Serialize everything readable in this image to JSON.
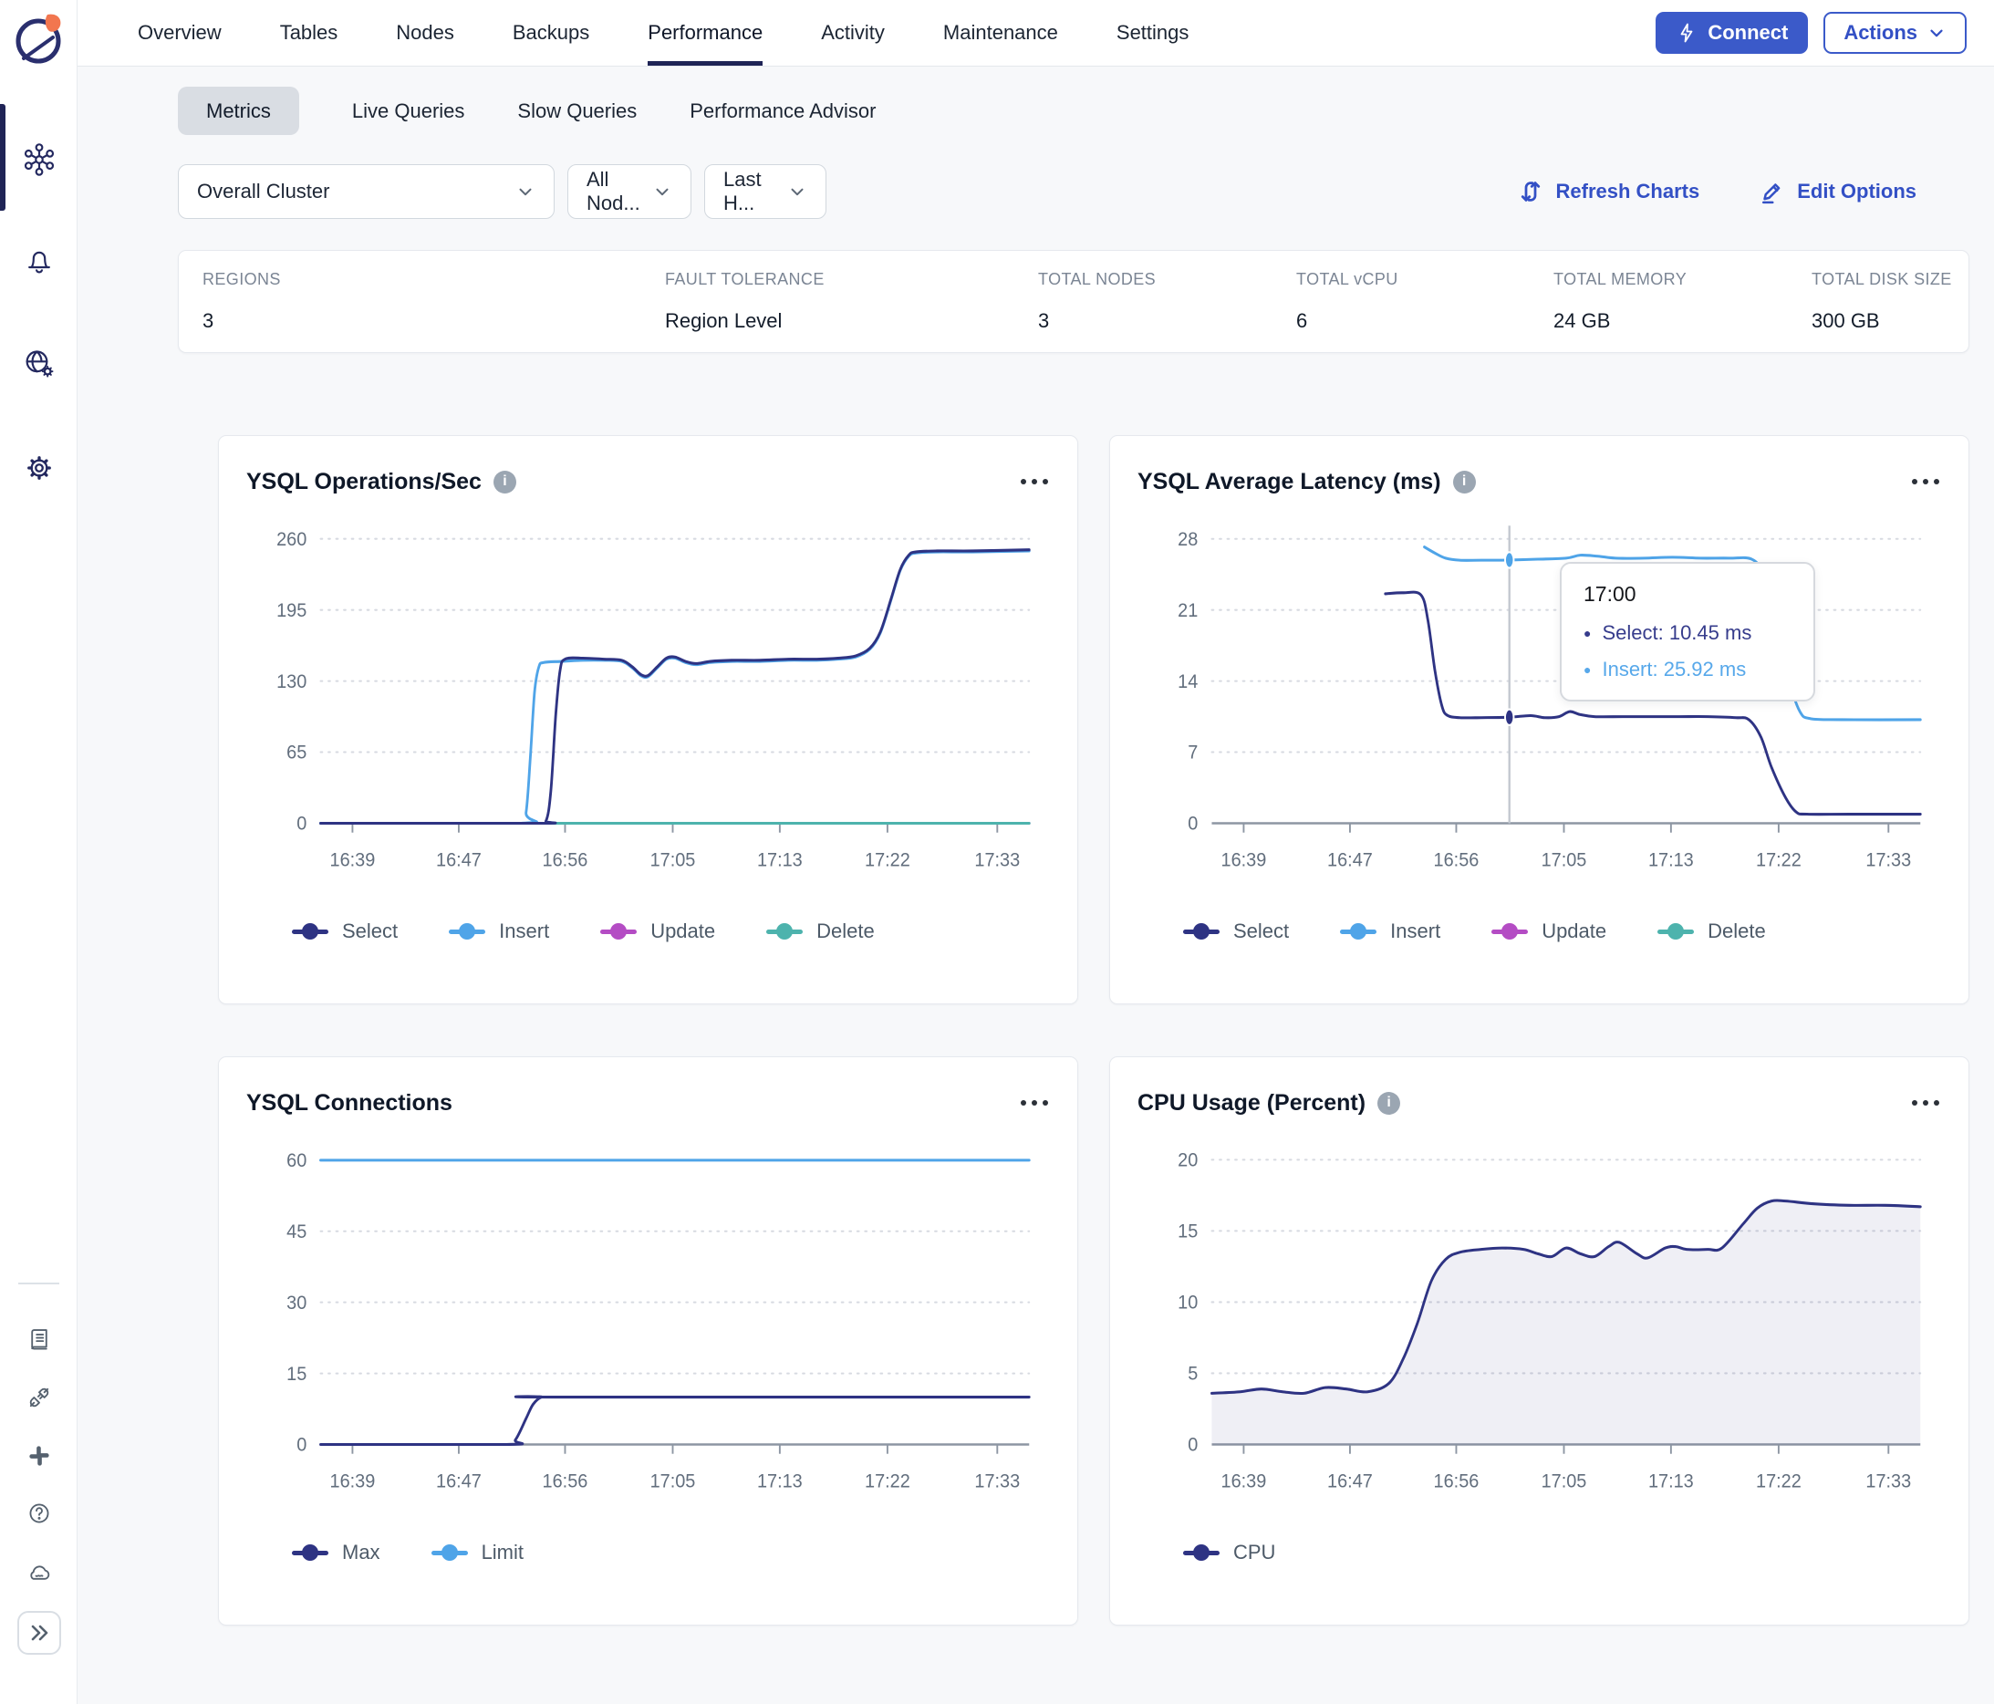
{
  "header": {
    "tabs": [
      "Overview",
      "Tables",
      "Nodes",
      "Backups",
      "Performance",
      "Activity",
      "Maintenance",
      "Settings"
    ],
    "active_tab": "Performance",
    "connect_label": "Connect",
    "actions_label": "Actions"
  },
  "subtabs": {
    "items": [
      "Metrics",
      "Live Queries",
      "Slow Queries",
      "Performance Advisor"
    ],
    "active": "Metrics"
  },
  "filters": {
    "cluster_select": "Overall Cluster",
    "nodes_select": "All Nod...",
    "time_select": "Last H...",
    "refresh_label": "Refresh Charts",
    "edit_label": "Edit Options"
  },
  "stats": [
    {
      "label": "REGIONS",
      "value": "3"
    },
    {
      "label": "FAULT TOLERANCE",
      "value": "Region Level"
    },
    {
      "label": "TOTAL NODES",
      "value": "3"
    },
    {
      "label": "TOTAL vCPU",
      "value": "6"
    },
    {
      "label": "TOTAL MEMORY",
      "value": "24 GB"
    },
    {
      "label": "TOTAL DISK SIZE",
      "value": "300 GB"
    }
  ],
  "tooltip": {
    "time": "17:00",
    "rows": [
      {
        "series": "Select",
        "text": "Select: 10.45 ms",
        "color": "#2e3383"
      },
      {
        "series": "Insert",
        "text": "Insert: 25.92 ms",
        "color": "#4fa4e8"
      }
    ]
  },
  "colors": {
    "accent_blue": "#3b5ac9",
    "select_navy": "#2e3383",
    "insert_blue": "#4fa4e8",
    "update_magenta": "#b44cc4",
    "delete_teal": "#4db3ad",
    "active_indicator": "#1f2456"
  },
  "chart_data": [
    {
      "type": "line",
      "title": "YSQL Operations/Sec",
      "xticks": [
        "16:39",
        "16:47",
        "16:56",
        "17:05",
        "17:13",
        "17:22",
        "17:33"
      ],
      "xtick_pos": [
        0.045,
        0.195,
        0.345,
        0.497,
        0.648,
        0.8,
        0.955
      ],
      "yticks": [
        0,
        65,
        130,
        195,
        260
      ],
      "ymax": 272,
      "legend": [
        {
          "name": "Select",
          "color": "#2e3383"
        },
        {
          "name": "Insert",
          "color": "#4fa4e8"
        },
        {
          "name": "Update",
          "color": "#b44cc4"
        },
        {
          "name": "Delete",
          "color": "#4db3ad"
        }
      ],
      "series": [
        {
          "name": "Update",
          "color": "#b44cc4",
          "points": [
            [
              0,
              0
            ],
            [
              1,
              0
            ]
          ]
        },
        {
          "name": "Delete",
          "color": "#4db3ad",
          "points": [
            [
              0,
              0
            ],
            [
              1,
              0
            ]
          ]
        },
        {
          "name": "Insert",
          "color": "#4fa4e8",
          "points": [
            [
              0,
              0
            ],
            [
              0.282,
              0
            ],
            [
              0.29,
              10
            ],
            [
              0.296,
              60
            ],
            [
              0.302,
              120
            ],
            [
              0.308,
              143
            ],
            [
              0.315,
              147
            ],
            [
              0.34,
              148
            ],
            [
              0.37,
              149
            ],
            [
              0.4,
              149
            ],
            [
              0.425,
              148
            ],
            [
              0.44,
              142
            ],
            [
              0.452,
              135
            ],
            [
              0.462,
              134
            ],
            [
              0.475,
              142
            ],
            [
              0.488,
              150
            ],
            [
              0.5,
              151
            ],
            [
              0.515,
              147
            ],
            [
              0.53,
              145
            ],
            [
              0.55,
              147
            ],
            [
              0.58,
              148
            ],
            [
              0.62,
              148
            ],
            [
              0.66,
              149
            ],
            [
              0.7,
              149
            ],
            [
              0.73,
              150
            ],
            [
              0.755,
              152
            ],
            [
              0.775,
              159
            ],
            [
              0.79,
              174
            ],
            [
              0.805,
              204
            ],
            [
              0.818,
              231
            ],
            [
              0.83,
              244
            ],
            [
              0.84,
              247
            ],
            [
              0.87,
              248
            ],
            [
              0.92,
              248
            ],
            [
              1,
              249
            ]
          ]
        },
        {
          "name": "Select",
          "color": "#2e3383",
          "points": [
            [
              0,
              0
            ],
            [
              0.305,
              0
            ],
            [
              0.318,
              2
            ],
            [
              0.325,
              30
            ],
            [
              0.332,
              100
            ],
            [
              0.338,
              140
            ],
            [
              0.345,
              150
            ],
            [
              0.37,
              151
            ],
            [
              0.4,
              150
            ],
            [
              0.425,
              149
            ],
            [
              0.44,
              143
            ],
            [
              0.452,
              136
            ],
            [
              0.462,
              135
            ],
            [
              0.475,
              143
            ],
            [
              0.488,
              151
            ],
            [
              0.5,
              152
            ],
            [
              0.515,
              148
            ],
            [
              0.53,
              146
            ],
            [
              0.55,
              148
            ],
            [
              0.58,
              149
            ],
            [
              0.62,
              149
            ],
            [
              0.66,
              150
            ],
            [
              0.7,
              150
            ],
            [
              0.73,
              151
            ],
            [
              0.755,
              153
            ],
            [
              0.775,
              160
            ],
            [
              0.79,
              175
            ],
            [
              0.805,
              205
            ],
            [
              0.818,
              232
            ],
            [
              0.83,
              245
            ],
            [
              0.84,
              248
            ],
            [
              0.87,
              249
            ],
            [
              0.92,
              249
            ],
            [
              1,
              250
            ]
          ]
        }
      ]
    },
    {
      "type": "line",
      "title": "YSQL Average Latency (ms)",
      "xticks": [
        "16:39",
        "16:47",
        "16:56",
        "17:05",
        "17:13",
        "17:22",
        "17:33"
      ],
      "xtick_pos": [
        0.045,
        0.195,
        0.345,
        0.497,
        0.648,
        0.8,
        0.955
      ],
      "yticks": [
        0,
        7,
        14,
        21,
        28
      ],
      "ymax": 29.3,
      "legend": [
        {
          "name": "Select",
          "color": "#2e3383"
        },
        {
          "name": "Insert",
          "color": "#4fa4e8"
        },
        {
          "name": "Update",
          "color": "#b44cc4"
        },
        {
          "name": "Delete",
          "color": "#4db3ad"
        }
      ],
      "crosshair": {
        "x": 0.42,
        "points": [
          {
            "y": 25.92,
            "color": "#4fa4e8"
          },
          {
            "y": 10.45,
            "color": "#2e3383"
          }
        ]
      },
      "series": [
        {
          "name": "Insert",
          "color": "#4fa4e8",
          "points": [
            [
              0.3,
              27.2
            ],
            [
              0.315,
              26.6
            ],
            [
              0.33,
              26.1
            ],
            [
              0.35,
              25.9
            ],
            [
              0.38,
              25.9
            ],
            [
              0.42,
              25.92
            ],
            [
              0.46,
              26.0
            ],
            [
              0.5,
              26.1
            ],
            [
              0.52,
              26.4
            ],
            [
              0.545,
              26.3
            ],
            [
              0.57,
              26.1
            ],
            [
              0.61,
              26.1
            ],
            [
              0.65,
              26.2
            ],
            [
              0.69,
              26.1
            ],
            [
              0.73,
              26.1
            ],
            [
              0.762,
              26.0
            ],
            [
              0.778,
              24.5
            ],
            [
              0.795,
              20
            ],
            [
              0.815,
              14
            ],
            [
              0.83,
              11
            ],
            [
              0.845,
              10.3
            ],
            [
              0.89,
              10.2
            ],
            [
              1,
              10.2
            ]
          ]
        },
        {
          "name": "Select",
          "color": "#2e3383",
          "points": [
            [
              0.245,
              22.6
            ],
            [
              0.27,
              22.7
            ],
            [
              0.295,
              22.5
            ],
            [
              0.305,
              20
            ],
            [
              0.315,
              15
            ],
            [
              0.325,
              11.5
            ],
            [
              0.333,
              10.6
            ],
            [
              0.35,
              10.4
            ],
            [
              0.38,
              10.4
            ],
            [
              0.42,
              10.45
            ],
            [
              0.45,
              10.6
            ],
            [
              0.47,
              10.4
            ],
            [
              0.49,
              10.5
            ],
            [
              0.505,
              11.0
            ],
            [
              0.52,
              10.7
            ],
            [
              0.54,
              10.5
            ],
            [
              0.58,
              10.5
            ],
            [
              0.62,
              10.5
            ],
            [
              0.66,
              10.5
            ],
            [
              0.7,
              10.5
            ],
            [
              0.74,
              10.4
            ],
            [
              0.758,
              10.2
            ],
            [
              0.775,
              8.5
            ],
            [
              0.79,
              5.5
            ],
            [
              0.81,
              2.5
            ],
            [
              0.825,
              1.1
            ],
            [
              0.84,
              0.9
            ],
            [
              0.9,
              0.9
            ],
            [
              1,
              0.9
            ]
          ]
        }
      ]
    },
    {
      "type": "line",
      "title": "YSQL Connections",
      "xticks": [
        "16:39",
        "16:47",
        "16:56",
        "17:05",
        "17:13",
        "17:22",
        "17:33"
      ],
      "xtick_pos": [
        0.045,
        0.195,
        0.345,
        0.497,
        0.648,
        0.8,
        0.955
      ],
      "yticks": [
        0,
        15,
        30,
        45,
        60
      ],
      "ymax": 62.8,
      "legend": [
        {
          "name": "Max",
          "color": "#2e3383"
        },
        {
          "name": "Limit",
          "color": "#4fa4e8"
        }
      ],
      "series": [
        {
          "name": "Limit",
          "color": "#4fa4e8",
          "points": [
            [
              0,
              60
            ],
            [
              1,
              60
            ]
          ]
        },
        {
          "name": "Max",
          "color": "#2e3383",
          "points": [
            [
              0,
              0
            ],
            [
              0.262,
              0
            ],
            [
              0.275,
              1
            ],
            [
              0.29,
              5.5
            ],
            [
              0.3,
              8.5
            ],
            [
              0.312,
              10
            ],
            [
              0.33,
              10
            ],
            [
              1,
              10
            ]
          ]
        }
      ]
    },
    {
      "type": "area",
      "title": "CPU Usage (Percent)",
      "xticks": [
        "16:39",
        "16:47",
        "16:56",
        "17:05",
        "17:13",
        "17:22",
        "17:33"
      ],
      "xtick_pos": [
        0.045,
        0.195,
        0.345,
        0.497,
        0.648,
        0.8,
        0.955
      ],
      "yticks": [
        0,
        5,
        10,
        15,
        20
      ],
      "ymax": 20.9,
      "legend": [
        {
          "name": "CPU",
          "color": "#2e3383"
        }
      ],
      "series": [
        {
          "name": "CPU",
          "color": "#2e3383",
          "fill": true,
          "points": [
            [
              0,
              3.6
            ],
            [
              0.04,
              3.7
            ],
            [
              0.07,
              3.9
            ],
            [
              0.1,
              3.7
            ],
            [
              0.13,
              3.6
            ],
            [
              0.16,
              4.0
            ],
            [
              0.19,
              3.9
            ],
            [
              0.22,
              3.7
            ],
            [
              0.25,
              4.3
            ],
            [
              0.27,
              6.0
            ],
            [
              0.29,
              8.5
            ],
            [
              0.31,
              11.5
            ],
            [
              0.33,
              13.0
            ],
            [
              0.35,
              13.5
            ],
            [
              0.38,
              13.7
            ],
            [
              0.41,
              13.8
            ],
            [
              0.44,
              13.7
            ],
            [
              0.46,
              13.4
            ],
            [
              0.48,
              13.2
            ],
            [
              0.5,
              13.8
            ],
            [
              0.52,
              13.4
            ],
            [
              0.54,
              13.2
            ],
            [
              0.56,
              13.9
            ],
            [
              0.575,
              14.2
            ],
            [
              0.6,
              13.4
            ],
            [
              0.615,
              13.1
            ],
            [
              0.64,
              13.8
            ],
            [
              0.655,
              13.9
            ],
            [
              0.67,
              13.7
            ],
            [
              0.7,
              13.7
            ],
            [
              0.72,
              13.8
            ],
            [
              0.75,
              15.5
            ],
            [
              0.77,
              16.6
            ],
            [
              0.79,
              17.1
            ],
            [
              0.81,
              17.1
            ],
            [
              0.85,
              16.9
            ],
            [
              0.9,
              16.8
            ],
            [
              0.95,
              16.8
            ],
            [
              1,
              16.7
            ]
          ]
        }
      ]
    }
  ]
}
